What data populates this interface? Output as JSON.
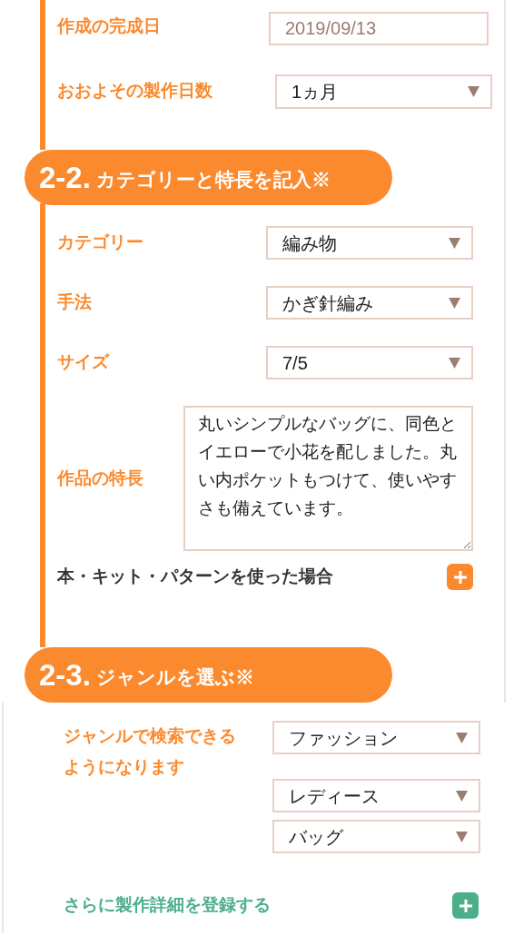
{
  "sections": [
    {
      "fields": [
        {
          "kind": "input",
          "label": "作成の完成日",
          "value": "2019/09/13"
        },
        {
          "kind": "select",
          "label": "おおよその製作日数",
          "value": "1ヵ月"
        }
      ]
    },
    {
      "number": "2-2.",
      "title": "カテゴリーと特長を記入※",
      "fields": [
        {
          "kind": "select",
          "label": "カテゴリー",
          "value": "編み物"
        },
        {
          "kind": "select",
          "label": "手法",
          "value": "かぎ針編み"
        },
        {
          "kind": "select",
          "label": "サイズ",
          "value": "7/5"
        },
        {
          "kind": "textarea",
          "label": "作品の特長",
          "value": "丸いシンプルなバッグに、同色とイエローで小花を配しました。丸い内ポケットもつけて、使いやすさも備えています。"
        }
      ],
      "expander": {
        "label": "本・キット・パターンを使った場合"
      }
    },
    {
      "number": "2-3.",
      "title": "ジャンルを選ぶ※",
      "genre": {
        "label": "ジャンルで検索できるようになります",
        "selects": [
          "ファッション",
          "レディース",
          "バッグ"
        ]
      },
      "expander": {
        "label": "さらに製作詳細を登録する"
      }
    }
  ]
}
